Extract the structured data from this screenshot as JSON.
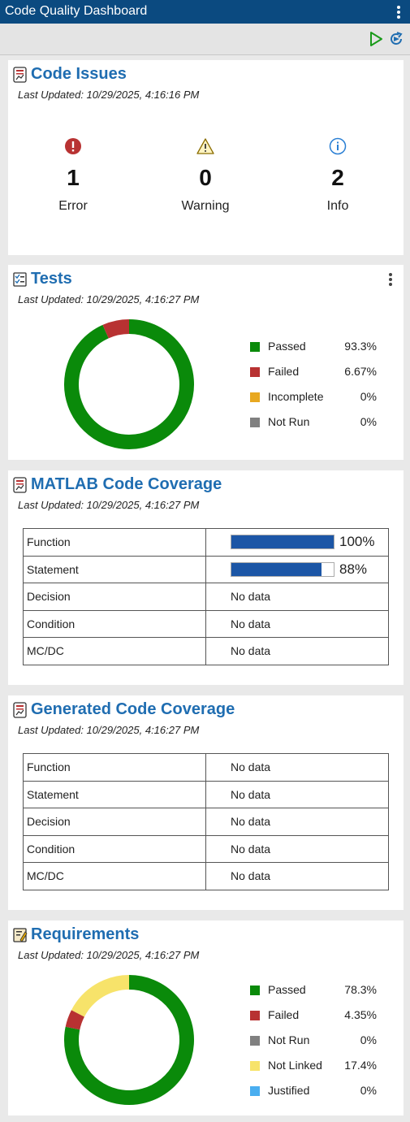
{
  "window": {
    "title": "Code Quality Dashboard"
  },
  "toolbar": {
    "run_icon": "play-icon",
    "refresh_icon": "refresh-icon"
  },
  "code_issues": {
    "title": "Code Issues",
    "updated": "Last Updated: 10/29/2025, 4:16:16 PM",
    "items": [
      {
        "count": "1",
        "label": "Error",
        "icon": "error-icon",
        "color": "#b83232"
      },
      {
        "count": "0",
        "label": "Warning",
        "icon": "warning-icon",
        "color": "#e0a400"
      },
      {
        "count": "2",
        "label": "Info",
        "icon": "info-icon",
        "color": "#2a7fd4"
      }
    ]
  },
  "tests": {
    "title": "Tests",
    "updated": "Last Updated: 10/29/2025, 4:16:27 PM",
    "legend": [
      {
        "name": "Passed",
        "pct": "93.3%",
        "value": 93.3,
        "color": "#0a8a0a"
      },
      {
        "name": "Failed",
        "pct": "6.67%",
        "value": 6.67,
        "color": "#b83232"
      },
      {
        "name": "Incomplete",
        "pct": "0%",
        "value": 0,
        "color": "#e8a820"
      },
      {
        "name": "Not Run",
        "pct": "0%",
        "value": 0,
        "color": "#808080"
      }
    ]
  },
  "matlab_coverage": {
    "title": "MATLAB Code Coverage",
    "updated": "Last Updated: 10/29/2025, 4:16:27 PM",
    "rows": [
      {
        "metric": "Function",
        "value": "100%",
        "fraction": 1.0
      },
      {
        "metric": "Statement",
        "value": "88%",
        "fraction": 0.88
      },
      {
        "metric": "Decision",
        "value": "No data"
      },
      {
        "metric": "Condition",
        "value": "No data"
      },
      {
        "metric": "MC/DC",
        "value": "No data"
      }
    ]
  },
  "generated_coverage": {
    "title": "Generated Code Coverage",
    "updated": "Last Updated: 10/29/2025, 4:16:27 PM",
    "rows": [
      {
        "metric": "Function",
        "value": "No data"
      },
      {
        "metric": "Statement",
        "value": "No data"
      },
      {
        "metric": "Decision",
        "value": "No data"
      },
      {
        "metric": "Condition",
        "value": "No data"
      },
      {
        "metric": "MC/DC",
        "value": "No data"
      }
    ]
  },
  "requirements": {
    "title": "Requirements",
    "updated": "Last Updated: 10/29/2025, 4:16:27 PM",
    "legend": [
      {
        "name": "Passed",
        "pct": "78.3%",
        "value": 78.3,
        "color": "#0a8a0a"
      },
      {
        "name": "Failed",
        "pct": "4.35%",
        "value": 4.35,
        "color": "#b83232"
      },
      {
        "name": "Not Run",
        "pct": "0%",
        "value": 0,
        "color": "#808080"
      },
      {
        "name": "Not Linked",
        "pct": "17.4%",
        "value": 17.4,
        "color": "#f7e36a"
      },
      {
        "name": "Justified",
        "pct": "0%",
        "value": 0,
        "color": "#4aaef0"
      }
    ]
  }
}
